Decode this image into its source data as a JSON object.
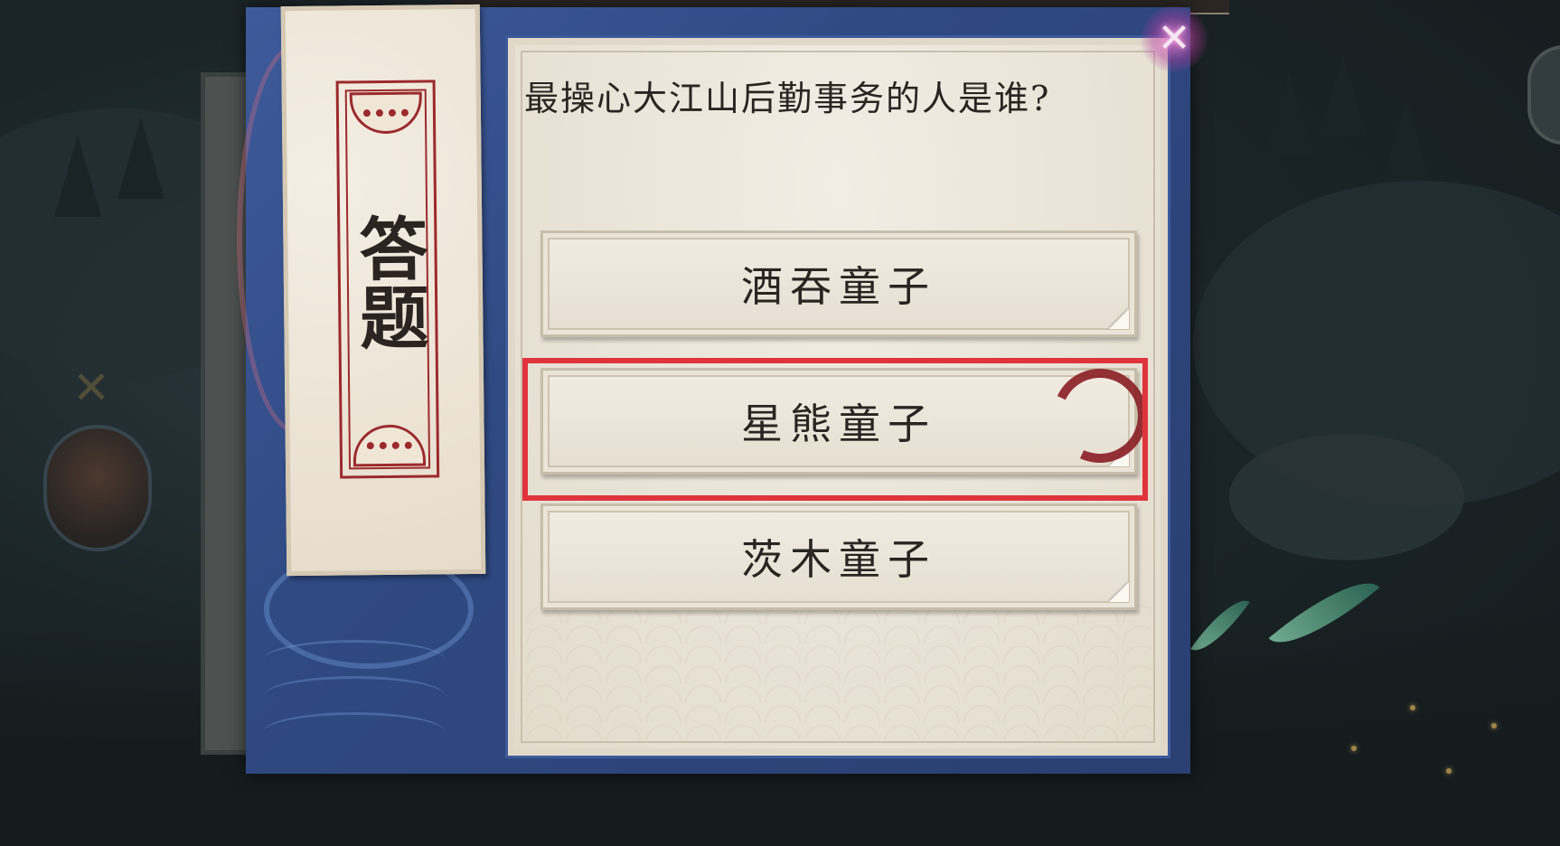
{
  "top_banner": {
    "text": ""
  },
  "quiz": {
    "title": "答题",
    "question": "最操心大江山后勤事务的人是谁?",
    "answers": [
      {
        "label": "酒吞童子",
        "highlighted": false
      },
      {
        "label": "星熊童子",
        "highlighted": true
      },
      {
        "label": "茨木童子",
        "highlighted": false
      }
    ],
    "highlight_color": "#e0343d",
    "close_icon": "close-icon"
  },
  "colors": {
    "book_cover": "#2f4982",
    "paper": "#e9e3d7",
    "seal_red": "#9c2a2c",
    "brush_mark": "#8a1e24"
  }
}
